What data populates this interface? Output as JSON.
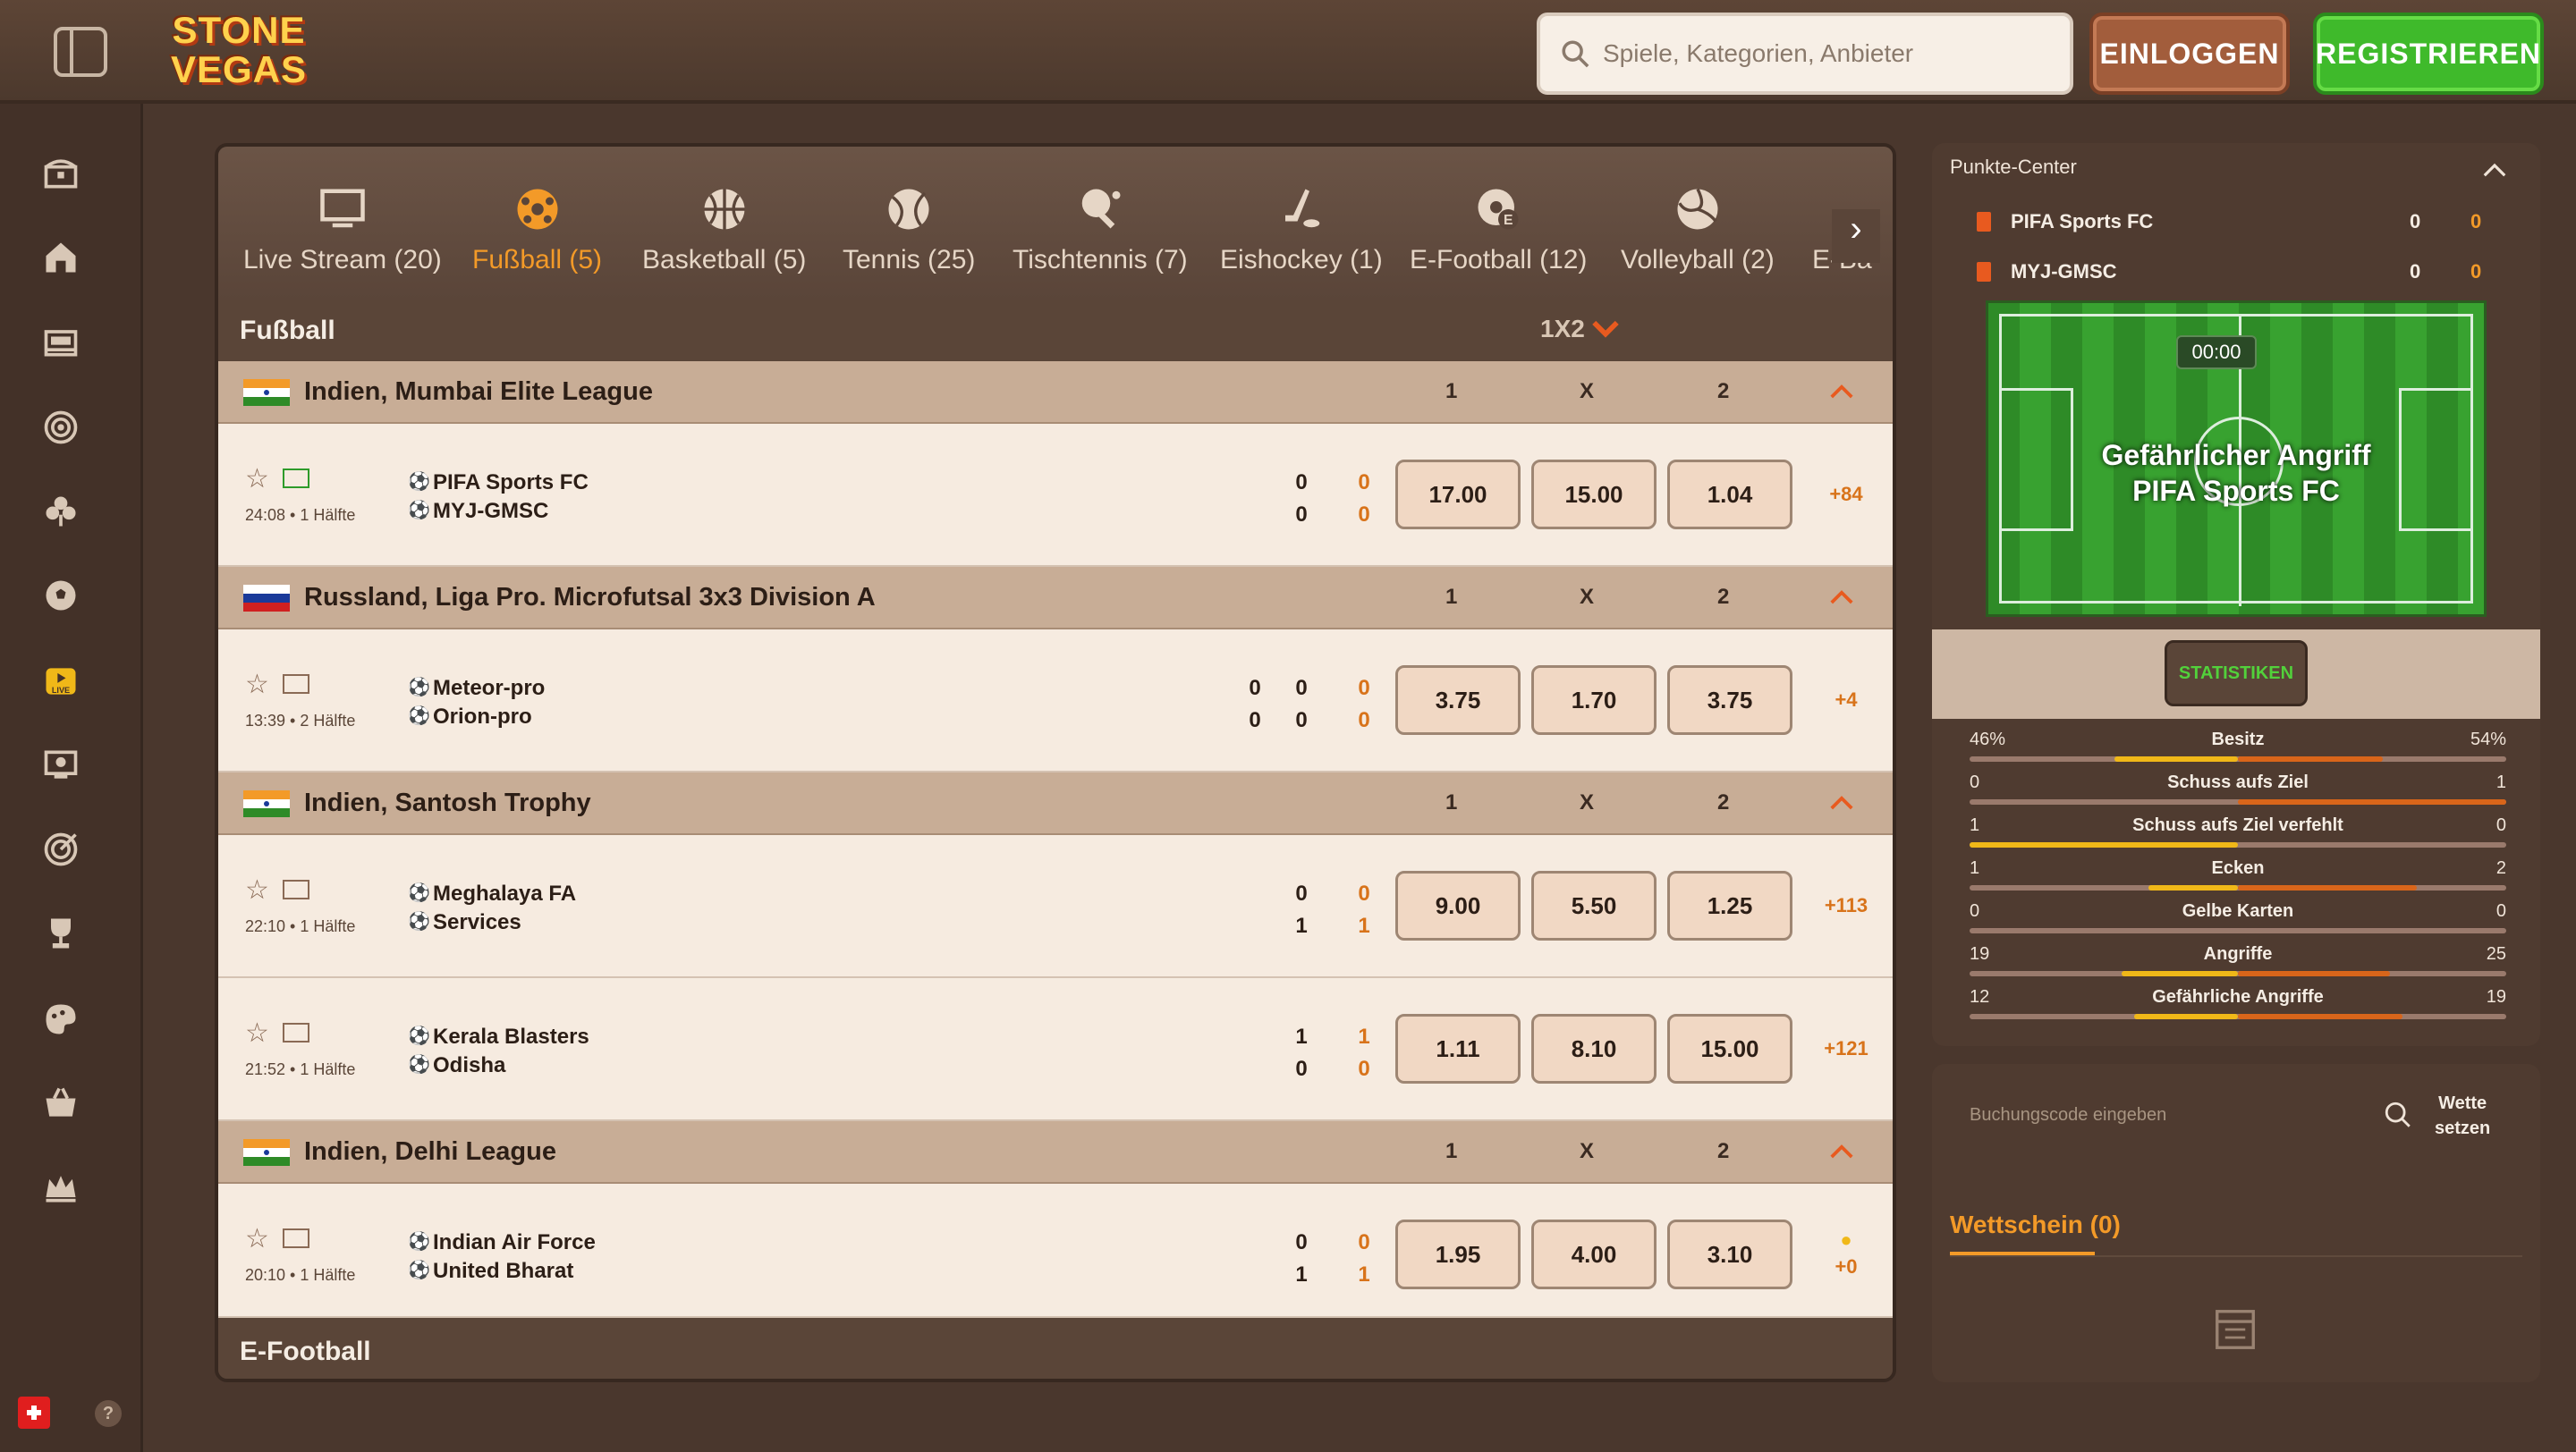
{
  "brand": {
    "line1": "STONE",
    "line2": "VEGAS"
  },
  "search": {
    "placeholder": "Spiele, Kategorien, Anbieter"
  },
  "header": {
    "login_label": "EINLOGGEN",
    "register_label": "REGISTRIEREN"
  },
  "sidebar": {
    "icons": [
      "treasure-chest-icon",
      "home-icon",
      "casino-icon",
      "roulette-icon",
      "clover-icon",
      "football-icon",
      "live-icon",
      "live-casino-icon",
      "target-icon",
      "trophy-icon",
      "palette-icon",
      "shop-icon",
      "crown-icon"
    ]
  },
  "tabs": [
    {
      "label": "Live Stream (20)",
      "icon": "monitor-icon"
    },
    {
      "label": "Fußball (5)",
      "icon": "football-icon",
      "active": true
    },
    {
      "label": "Basketball (5)",
      "icon": "basketball-icon"
    },
    {
      "label": "Tennis (25)",
      "icon": "tennis-icon"
    },
    {
      "label": "Tischtennis (7)",
      "icon": "table-tennis-icon"
    },
    {
      "label": "Eishockey (1)",
      "icon": "ice-hockey-icon"
    },
    {
      "label": "E-Football (12)",
      "icon": "e-football-icon"
    },
    {
      "label": "Volleyball (2)",
      "icon": "volleyball-icon"
    },
    {
      "label": "E-Ba",
      "icon": ""
    }
  ],
  "section": {
    "title": "Fußball",
    "market": "1X2"
  },
  "col_labels": [
    "1",
    "X",
    "2"
  ],
  "leagues": [
    {
      "name": "Indien, Mumbai Elite League",
      "flag": "india",
      "events": [
        {
          "time": "24:08 • 1 Hälfte",
          "home": "PIFA Sports FC",
          "away": "MYJ-GMSC",
          "scores": [
            [
              "0",
              "0"
            ],
            [
              "0",
              "0"
            ]
          ],
          "odds": [
            "17.00",
            "15.00",
            "1.04"
          ],
          "more": "+84"
        }
      ]
    },
    {
      "name": "Russland, Liga Pro. Microfutsal 3x3 Division A",
      "flag": "russia",
      "events": [
        {
          "time": "13:39 • 2 Hälfte",
          "home": "Meteor-pro",
          "away": "Orion-pro",
          "scores": [
            [
              "0",
              "0",
              "0"
            ],
            [
              "0",
              "0",
              "0"
            ]
          ],
          "odds": [
            "3.75",
            "1.70",
            "3.75"
          ],
          "more": "+4"
        }
      ]
    },
    {
      "name": "Indien, Santosh Trophy",
      "flag": "india",
      "events": [
        {
          "time": "22:10 • 1 Hälfte",
          "home": "Meghalaya FA",
          "away": "Services",
          "scores": [
            [
              "0",
              "0"
            ],
            [
              "1",
              "1"
            ]
          ],
          "odds": [
            "9.00",
            "5.50",
            "1.25"
          ],
          "more": "+113"
        },
        {
          "time": "21:52 • 1 Hälfte",
          "home": "Kerala Blasters",
          "away": "Odisha",
          "scores": [
            [
              "1",
              "1"
            ],
            [
              "0",
              "0"
            ]
          ],
          "odds": [
            "1.11",
            "8.10",
            "15.00"
          ],
          "more": "+121"
        }
      ]
    },
    {
      "name": "Indien, Delhi League",
      "flag": "india",
      "events": [
        {
          "time": "20:10 • 1 Hälfte",
          "home": "Indian Air Force",
          "away": "United Bharat",
          "scores": [
            [
              "0",
              "0"
            ],
            [
              "1",
              "1"
            ]
          ],
          "odds": [
            "1.95",
            "4.00",
            "3.10"
          ],
          "more": "+0"
        }
      ]
    }
  ],
  "next_section": "E-Football",
  "points_center": {
    "title": "Punkte-Center",
    "teams": [
      {
        "name": "PIFA Sports FC",
        "s1": "0",
        "s2": "0"
      },
      {
        "name": "MYJ-GMSC",
        "s1": "0",
        "s2": "0"
      }
    ],
    "clock": "00:00",
    "event_line1": "Gefährlicher Angriff",
    "event_line2": "PIFA  Sports FC",
    "stats_button": "STATISTIKEN",
    "stats": [
      {
        "name": "Besitz",
        "left": "46%",
        "right": "54%",
        "lv": 46,
        "rv": 54
      },
      {
        "name": "Schuss aufs Ziel",
        "left": "0",
        "right": "1",
        "lv": 0,
        "rv": 1
      },
      {
        "name": "Schuss aufs Ziel verfehlt",
        "left": "1",
        "right": "0",
        "lv": 1,
        "rv": 0
      },
      {
        "name": "Ecken",
        "left": "1",
        "right": "2",
        "lv": 1,
        "rv": 2
      },
      {
        "name": "Gelbe Karten",
        "left": "0",
        "right": "0",
        "lv": 0,
        "rv": 0
      },
      {
        "name": "Angriffe",
        "left": "19",
        "right": "25",
        "lv": 19,
        "rv": 25
      },
      {
        "name": "Gefährliche Angriffe",
        "left": "12",
        "right": "19",
        "lv": 12,
        "rv": 19
      }
    ]
  },
  "betslip": {
    "code_placeholder": "Buchungscode eingeben",
    "place_line1": "Wette",
    "place_line2": "setzen",
    "tab": "Wettschein (0)"
  },
  "colors": {
    "accent": "#f39a28",
    "register": "#3fba2b",
    "live_red": "#d8731a"
  }
}
